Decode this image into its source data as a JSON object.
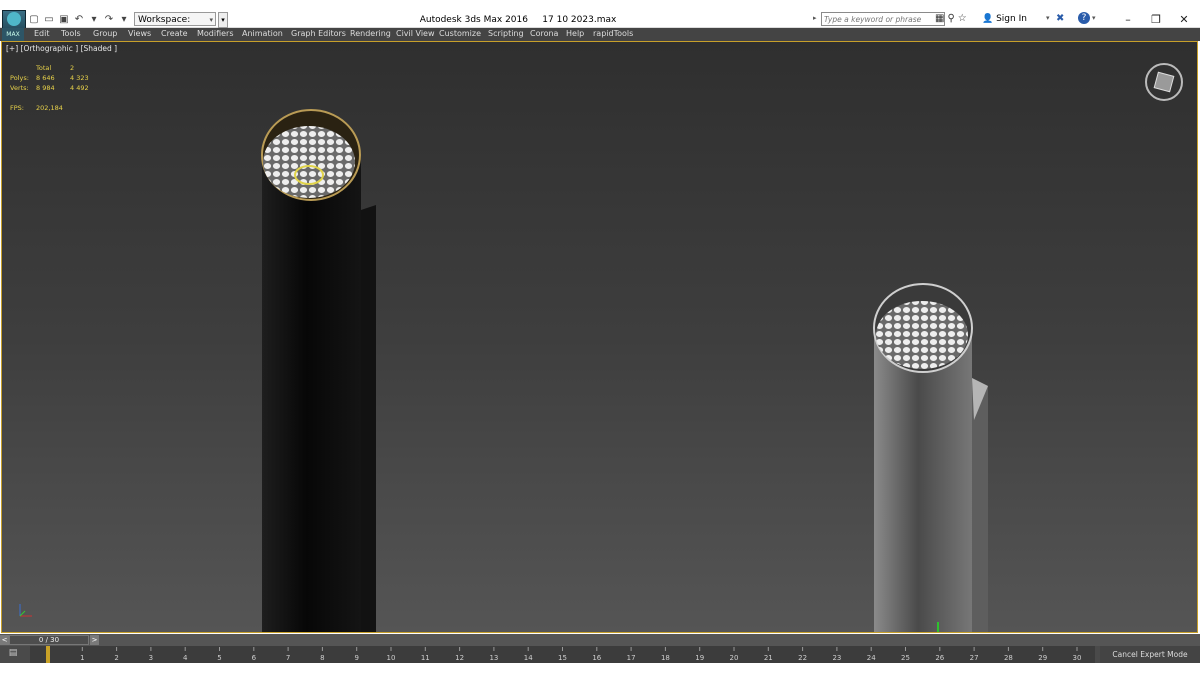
{
  "window": {
    "title": "Autodesk 3ds Max 2016",
    "file": "17 10 2023.max",
    "minimize": "–",
    "restore": "❐",
    "close": "✕"
  },
  "app_logo": {
    "text": "MAX"
  },
  "quick_access": {
    "icons": [
      "new-file-icon",
      "open-file-icon",
      "save-icon",
      "undo-icon",
      "undo-dropdown-icon",
      "redo-icon",
      "redo-dropdown-icon",
      "project-folder-icon"
    ],
    "glyphs": [
      "▢",
      "▭",
      "▣",
      "↶",
      "▾",
      "↷",
      "▾",
      "▤"
    ]
  },
  "workspace": {
    "label": "Workspace: Default",
    "dd": "▾",
    "extra": "▾"
  },
  "search": {
    "placeholder": "Type a keyword or phrase",
    "arrow": "▸"
  },
  "toolbar_right": {
    "glyphs": [
      "▦",
      "⚲",
      "☆"
    ],
    "signin_label": "Sign In",
    "signin_dd": "▾",
    "exchange": "✖",
    "help": "?",
    "help_dd": "▾"
  },
  "menu": {
    "items": [
      "Edit",
      "Tools",
      "Group",
      "Views",
      "Create",
      "Modifiers",
      "Animation",
      "Graph Editors",
      "Rendering",
      "Civil View",
      "Customize",
      "Scripting",
      "Corona",
      "Help",
      "rapidTools"
    ]
  },
  "viewport": {
    "label": "[+] [Orthographic ] [Shaded ]",
    "stats": {
      "header_label": "Total",
      "header_value": "2",
      "polys_label": "Polys:",
      "polys_total": "8 646",
      "polys_sel": "4 323",
      "verts_label": "Verts:",
      "verts_total": "8 984",
      "verts_sel": "4 492",
      "fps_label": "FPS:",
      "fps_value": "202,184"
    }
  },
  "timeline": {
    "frame": "0 / 30",
    "prev": "<",
    "next": ">",
    "ticks": [
      "0",
      "1",
      "2",
      "3",
      "4",
      "5",
      "6",
      "7",
      "8",
      "9",
      "10",
      "11",
      "12",
      "13",
      "14",
      "15",
      "16",
      "17",
      "18",
      "19",
      "20",
      "21",
      "22",
      "23",
      "24",
      "25",
      "26",
      "27",
      "28",
      "29",
      "30"
    ]
  },
  "status": {
    "cancel_expert": "Cancel Expert Mode",
    "trackbar_icon": "▤"
  },
  "colors": {
    "viewport_border": "#c8a02a",
    "stats_text": "#e8d24a",
    "menubar_bg": "#444444",
    "help_accent": "#2a5caa"
  }
}
